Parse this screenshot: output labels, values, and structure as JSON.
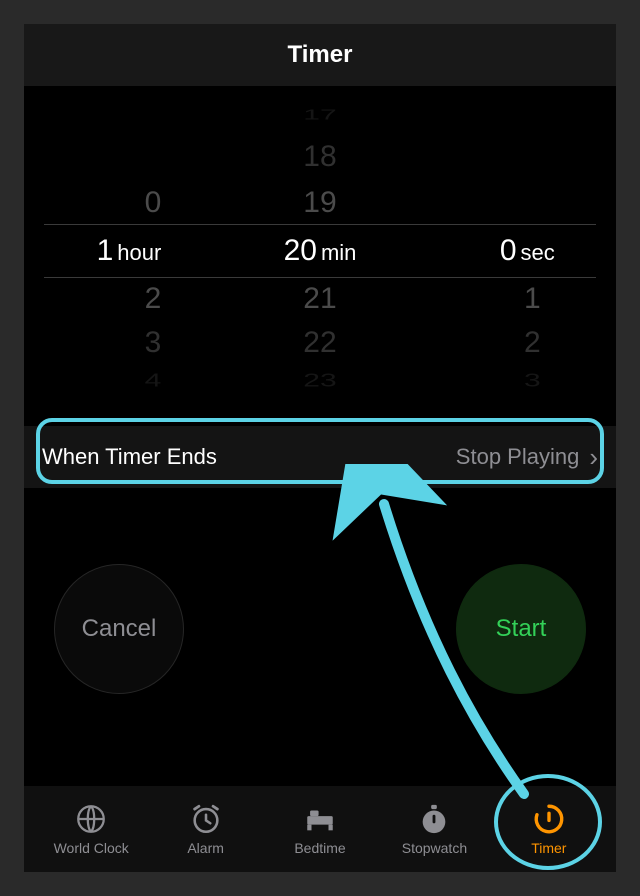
{
  "header": {
    "title": "Timer"
  },
  "picker": {
    "hours": {
      "above": [
        "0"
      ],
      "selected": "1",
      "unit": "hour",
      "below": [
        "2",
        "3",
        "4"
      ]
    },
    "minutes": {
      "above": [
        "17",
        "18",
        "19"
      ],
      "selected": "20",
      "unit": "min",
      "below": [
        "21",
        "22",
        "23"
      ]
    },
    "seconds": {
      "above": [
        ""
      ],
      "selected": "0",
      "unit": "sec",
      "below": [
        "1",
        "2",
        "3"
      ]
    }
  },
  "end_row": {
    "label": "When Timer Ends",
    "value": "Stop Playing"
  },
  "buttons": {
    "cancel": "Cancel",
    "start": "Start"
  },
  "tabs": {
    "items": [
      {
        "label": "World Clock"
      },
      {
        "label": "Alarm"
      },
      {
        "label": "Bedtime"
      },
      {
        "label": "Stopwatch"
      },
      {
        "label": "Timer"
      }
    ]
  }
}
